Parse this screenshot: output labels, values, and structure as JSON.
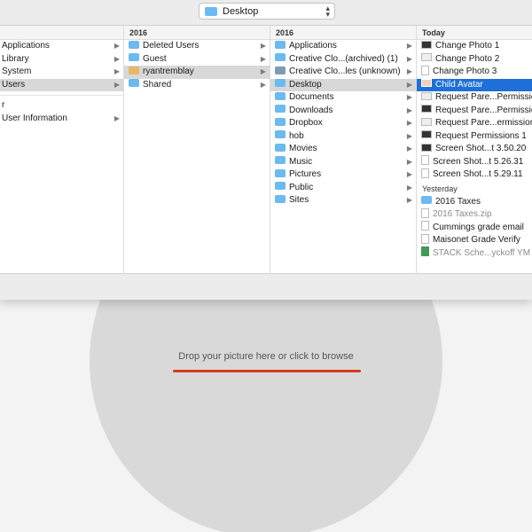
{
  "location": {
    "label": "Desktop",
    "chevron": "⌃⌄"
  },
  "columns": {
    "col1": {
      "items": [
        {
          "label": "Applications",
          "arrow": "▶",
          "selected": false
        },
        {
          "label": "Library",
          "arrow": "▶",
          "selected": false
        },
        {
          "label": "System",
          "arrow": "▶",
          "selected": false
        },
        {
          "label": "Users",
          "arrow": "▶",
          "selected": true
        },
        {
          "label": "r",
          "arrow": "",
          "selected": false
        },
        {
          "label": "User Information",
          "arrow": "▶",
          "selected": false
        }
      ]
    },
    "col2": {
      "header": "2016",
      "items": [
        {
          "label": "Deleted Users",
          "icon": "folder-icon",
          "arrow": "▶"
        },
        {
          "label": "Guest",
          "icon": "folder-icon",
          "arrow": "▶"
        },
        {
          "label": "ryantremblay",
          "icon": "home-icon",
          "arrow": "▶"
        },
        {
          "label": "Shared",
          "icon": "folder-icon",
          "arrow": "▶"
        }
      ]
    },
    "col3": {
      "header": "2016",
      "items": [
        {
          "label": "Applications",
          "icon": "folder-icon",
          "arrow": "▶"
        },
        {
          "label": "Creative Clo...(archived) (1)",
          "icon": "folder-icon",
          "arrow": "▶"
        },
        {
          "label": "Creative Clo...les (unknown)",
          "icon": "folder-icon",
          "arrow": "▶"
        },
        {
          "label": "Desktop",
          "icon": "folder-icon",
          "arrow": "▶"
        },
        {
          "label": "Documents",
          "icon": "folder-icon",
          "arrow": "▶"
        },
        {
          "label": "Downloads",
          "icon": "folder-icon",
          "arrow": "▶"
        },
        {
          "label": "Dropbox",
          "icon": "folder-icon",
          "arrow": "▶"
        },
        {
          "label": "hob",
          "icon": "folder-icon",
          "arrow": "▶"
        },
        {
          "label": "Movies",
          "icon": "folder-icon",
          "arrow": "▶"
        },
        {
          "label": "Music",
          "icon": "folder-icon",
          "arrow": "▶"
        },
        {
          "label": "Pictures",
          "icon": "folder-icon",
          "arrow": "▶"
        },
        {
          "label": "Public",
          "icon": "folder-icon",
          "arrow": "▶"
        },
        {
          "label": "Sites",
          "icon": "folder-icon",
          "arrow": "▶"
        }
      ]
    },
    "col4": {
      "header_today": "Today",
      "today": [
        {
          "label": "Change Photo 1",
          "icon": "image-icon"
        },
        {
          "label": "Change Photo 2",
          "icon": "image-icon"
        },
        {
          "label": "Change Photo 3",
          "icon": "document-icon"
        },
        {
          "label": "Child Avatar",
          "icon": "avatar-icon"
        },
        {
          "label": "Request Pare...Permissio",
          "icon": "image-icon"
        },
        {
          "label": "Request Pare...Permissio",
          "icon": "image-icon"
        },
        {
          "label": "Request Pare...ermission",
          "icon": "image-icon"
        },
        {
          "label": "Request Permissions 1",
          "icon": "image-icon"
        },
        {
          "label": "Screen Shot...t 3.50.20",
          "icon": "image-icon"
        },
        {
          "label": "Screen Shot...t 5.26.31",
          "icon": "document-icon"
        },
        {
          "label": "Screen Shot...t 5.29.11",
          "icon": "document-icon"
        }
      ],
      "header_yesterday": "Yesterday",
      "yesterday": [
        {
          "label": "2016 Taxes",
          "icon": "folder-icon"
        },
        {
          "label": "2016 Taxes.zip",
          "icon": "zip-icon"
        },
        {
          "label": "Cummings grade email",
          "icon": "document-icon"
        },
        {
          "label": "Maisonet Grade Verify",
          "icon": "document-icon"
        },
        {
          "label": "STACK Sche...yckoff YM",
          "icon": "spreadsheet-icon"
        }
      ]
    }
  },
  "drop_zone": {
    "text": "Drop your picture here or click to browse"
  },
  "colors": {
    "selection_blue": "#1e6fd8",
    "underline_red": "#d83a1e",
    "circle_gray": "#d9d9d9"
  }
}
